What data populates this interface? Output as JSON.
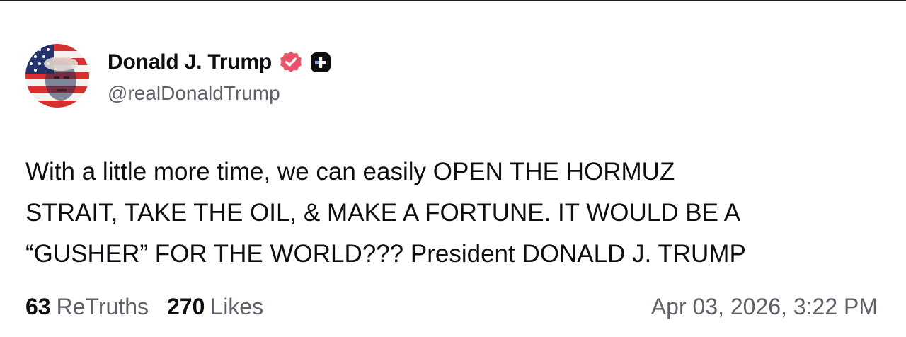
{
  "author": {
    "display_name": "Donald J. Trump",
    "handle": "@realDonaldTrump",
    "avatar_icon": "profile-avatar-flag-portrait",
    "verified_icon": "verified-badge-icon",
    "verified_color": "#e8536a",
    "subscriber_icon": "plus-badge-icon"
  },
  "post": {
    "lines": [
      "With a little more time, we can easily OPEN THE HORMUZ",
      "STRAIT, TAKE THE OIL, & MAKE A FORTUNE. IT WOULD BE A",
      "“GUSHER” FOR THE WORLD??? President DONALD J. TRUMP"
    ]
  },
  "stats": {
    "retruths_count": "63",
    "retruths_label": "ReTruths",
    "likes_count": "270",
    "likes_label": "Likes"
  },
  "timestamp": "Apr 03, 2026, 3:22 PM"
}
